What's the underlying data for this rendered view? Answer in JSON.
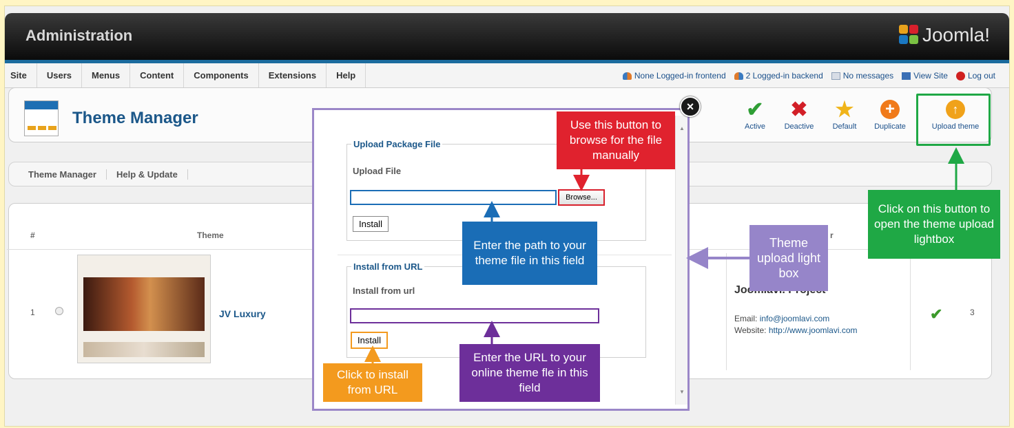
{
  "header": {
    "title": "Administration",
    "logo_text": "Joomla!"
  },
  "menu": {
    "items": [
      {
        "label": "Site"
      },
      {
        "label": "Users"
      },
      {
        "label": "Menus"
      },
      {
        "label": "Content"
      },
      {
        "label": "Components"
      },
      {
        "label": "Extensions"
      },
      {
        "label": "Help"
      }
    ]
  },
  "status": {
    "frontend": "None Logged-in frontend",
    "backend": "2 Logged-in backend",
    "messages": "No messages",
    "view_site": "View Site",
    "logout": "Log out"
  },
  "toolbar": {
    "page_title": "Theme Manager",
    "buttons": {
      "active": "Active",
      "deactive": "Deactive",
      "default": "Default",
      "duplicate": "Duplicate",
      "upload": "Upload theme"
    }
  },
  "submenu": {
    "items": [
      {
        "label": "Theme Manager"
      },
      {
        "label": "Help & Update"
      }
    ]
  },
  "table": {
    "headers": {
      "num": "#",
      "theme": "Theme",
      "author": "r"
    },
    "row": {
      "num": "1",
      "theme_name": "JV Luxury",
      "author_name": "Joomlavi. Project",
      "email_label": "Email:",
      "email": "info@joomlavi.com",
      "website_label": "Website:",
      "website": "http://www.joomlavi.com",
      "count": "3"
    }
  },
  "lightbox": {
    "upload_legend": "Upload Package File",
    "upload_label": "Upload File",
    "browse_label": "Browse...",
    "install_label": "Install",
    "url_legend": "Install from URL",
    "url_label": "Install from url",
    "url_install_label": "Install"
  },
  "callouts": {
    "browse": "Use this button to browse for the file manually",
    "path": "Enter the path to your theme file in this field",
    "url": "Enter the URL to your online theme fle in this field",
    "install_url": "Click to install from URL",
    "lightbox": "Theme upload light box",
    "upload_button": "Click on this button to open the theme upload lightbox"
  },
  "colors": {
    "red": "#e0222e",
    "blue": "#1a6db6",
    "purple": "#6d2f9a",
    "orange": "#f39a1e",
    "lavender": "#9685c9",
    "green": "#1fa845"
  }
}
